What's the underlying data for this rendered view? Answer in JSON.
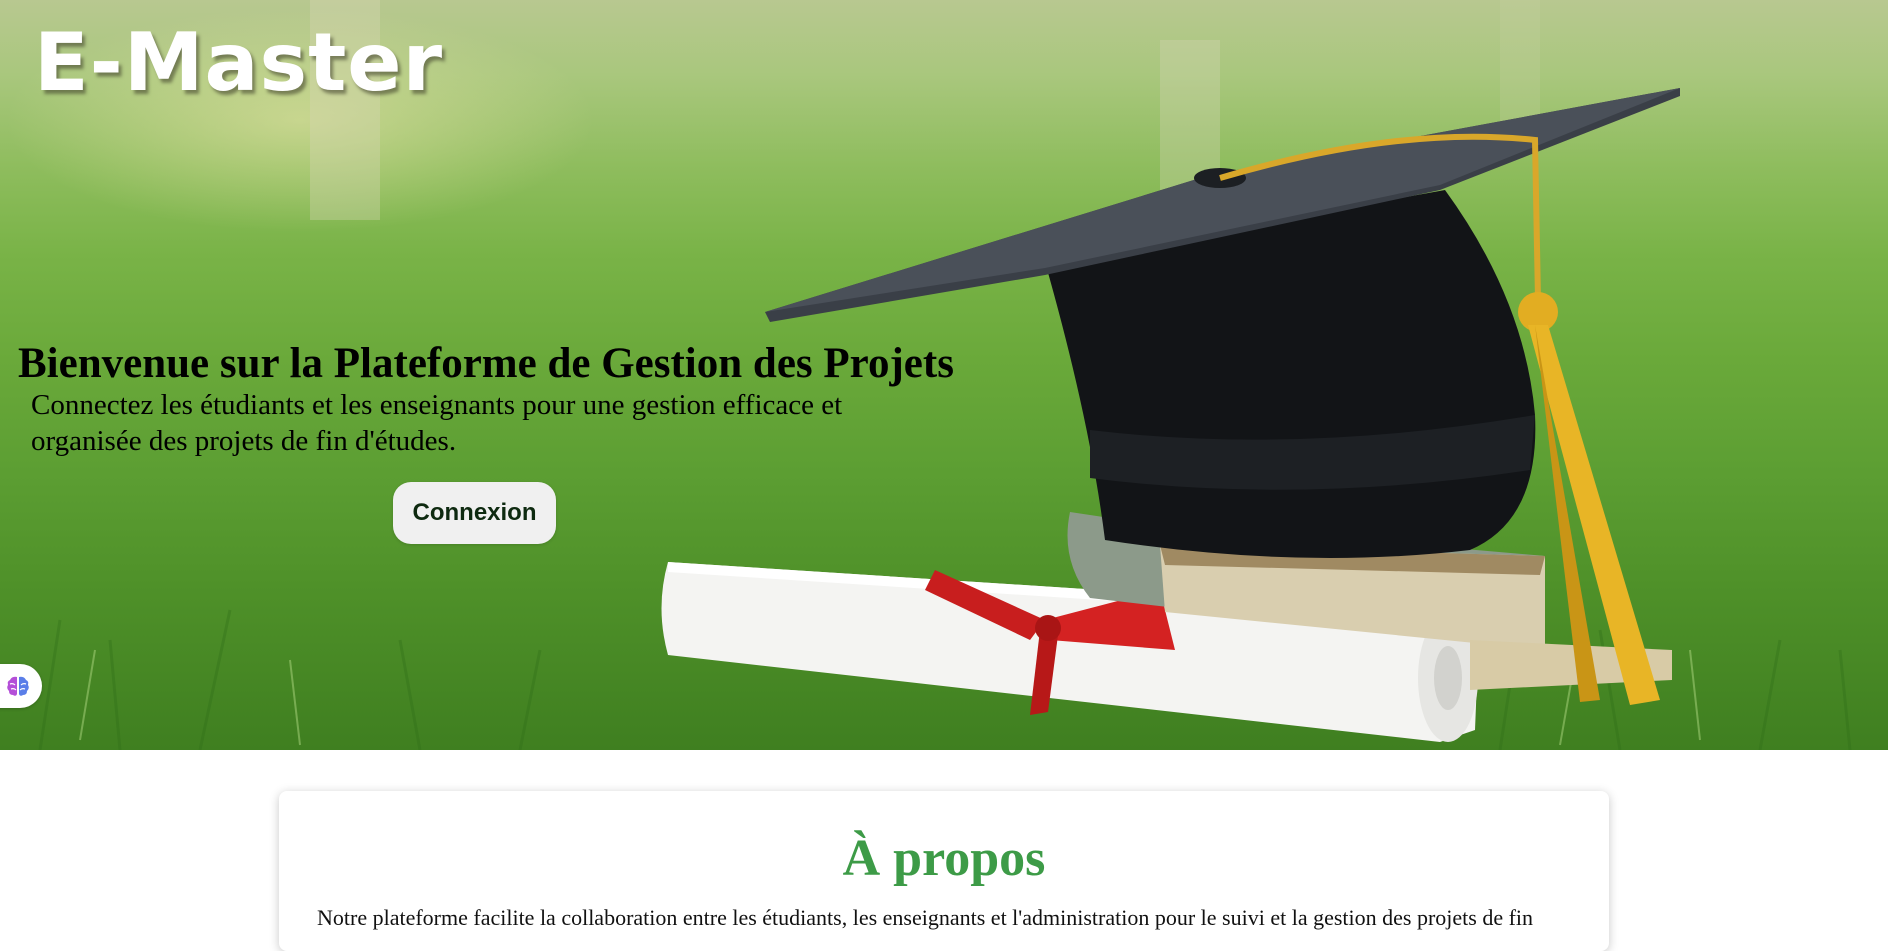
{
  "brand": {
    "logo_text": "E-Master"
  },
  "hero": {
    "title": "Bienvenue sur la Plateforme de Gestion des Projets",
    "subtitle": "Connectez les étudiants et les enseignants pour une gestion efficace et organisée des projets de fin d'études.",
    "login_label": "Connexion"
  },
  "about": {
    "title": "À propos",
    "text": "Notre plateforme facilite la collaboration entre les étudiants, les enseignants et l'administration pour le suivi et la gestion des projets de fin"
  },
  "widget": {
    "icon": "brain-icon"
  },
  "colors": {
    "accent_green": "#3d9b47",
    "button_bg": "#f0f0f0",
    "button_text": "#0e2a10"
  }
}
